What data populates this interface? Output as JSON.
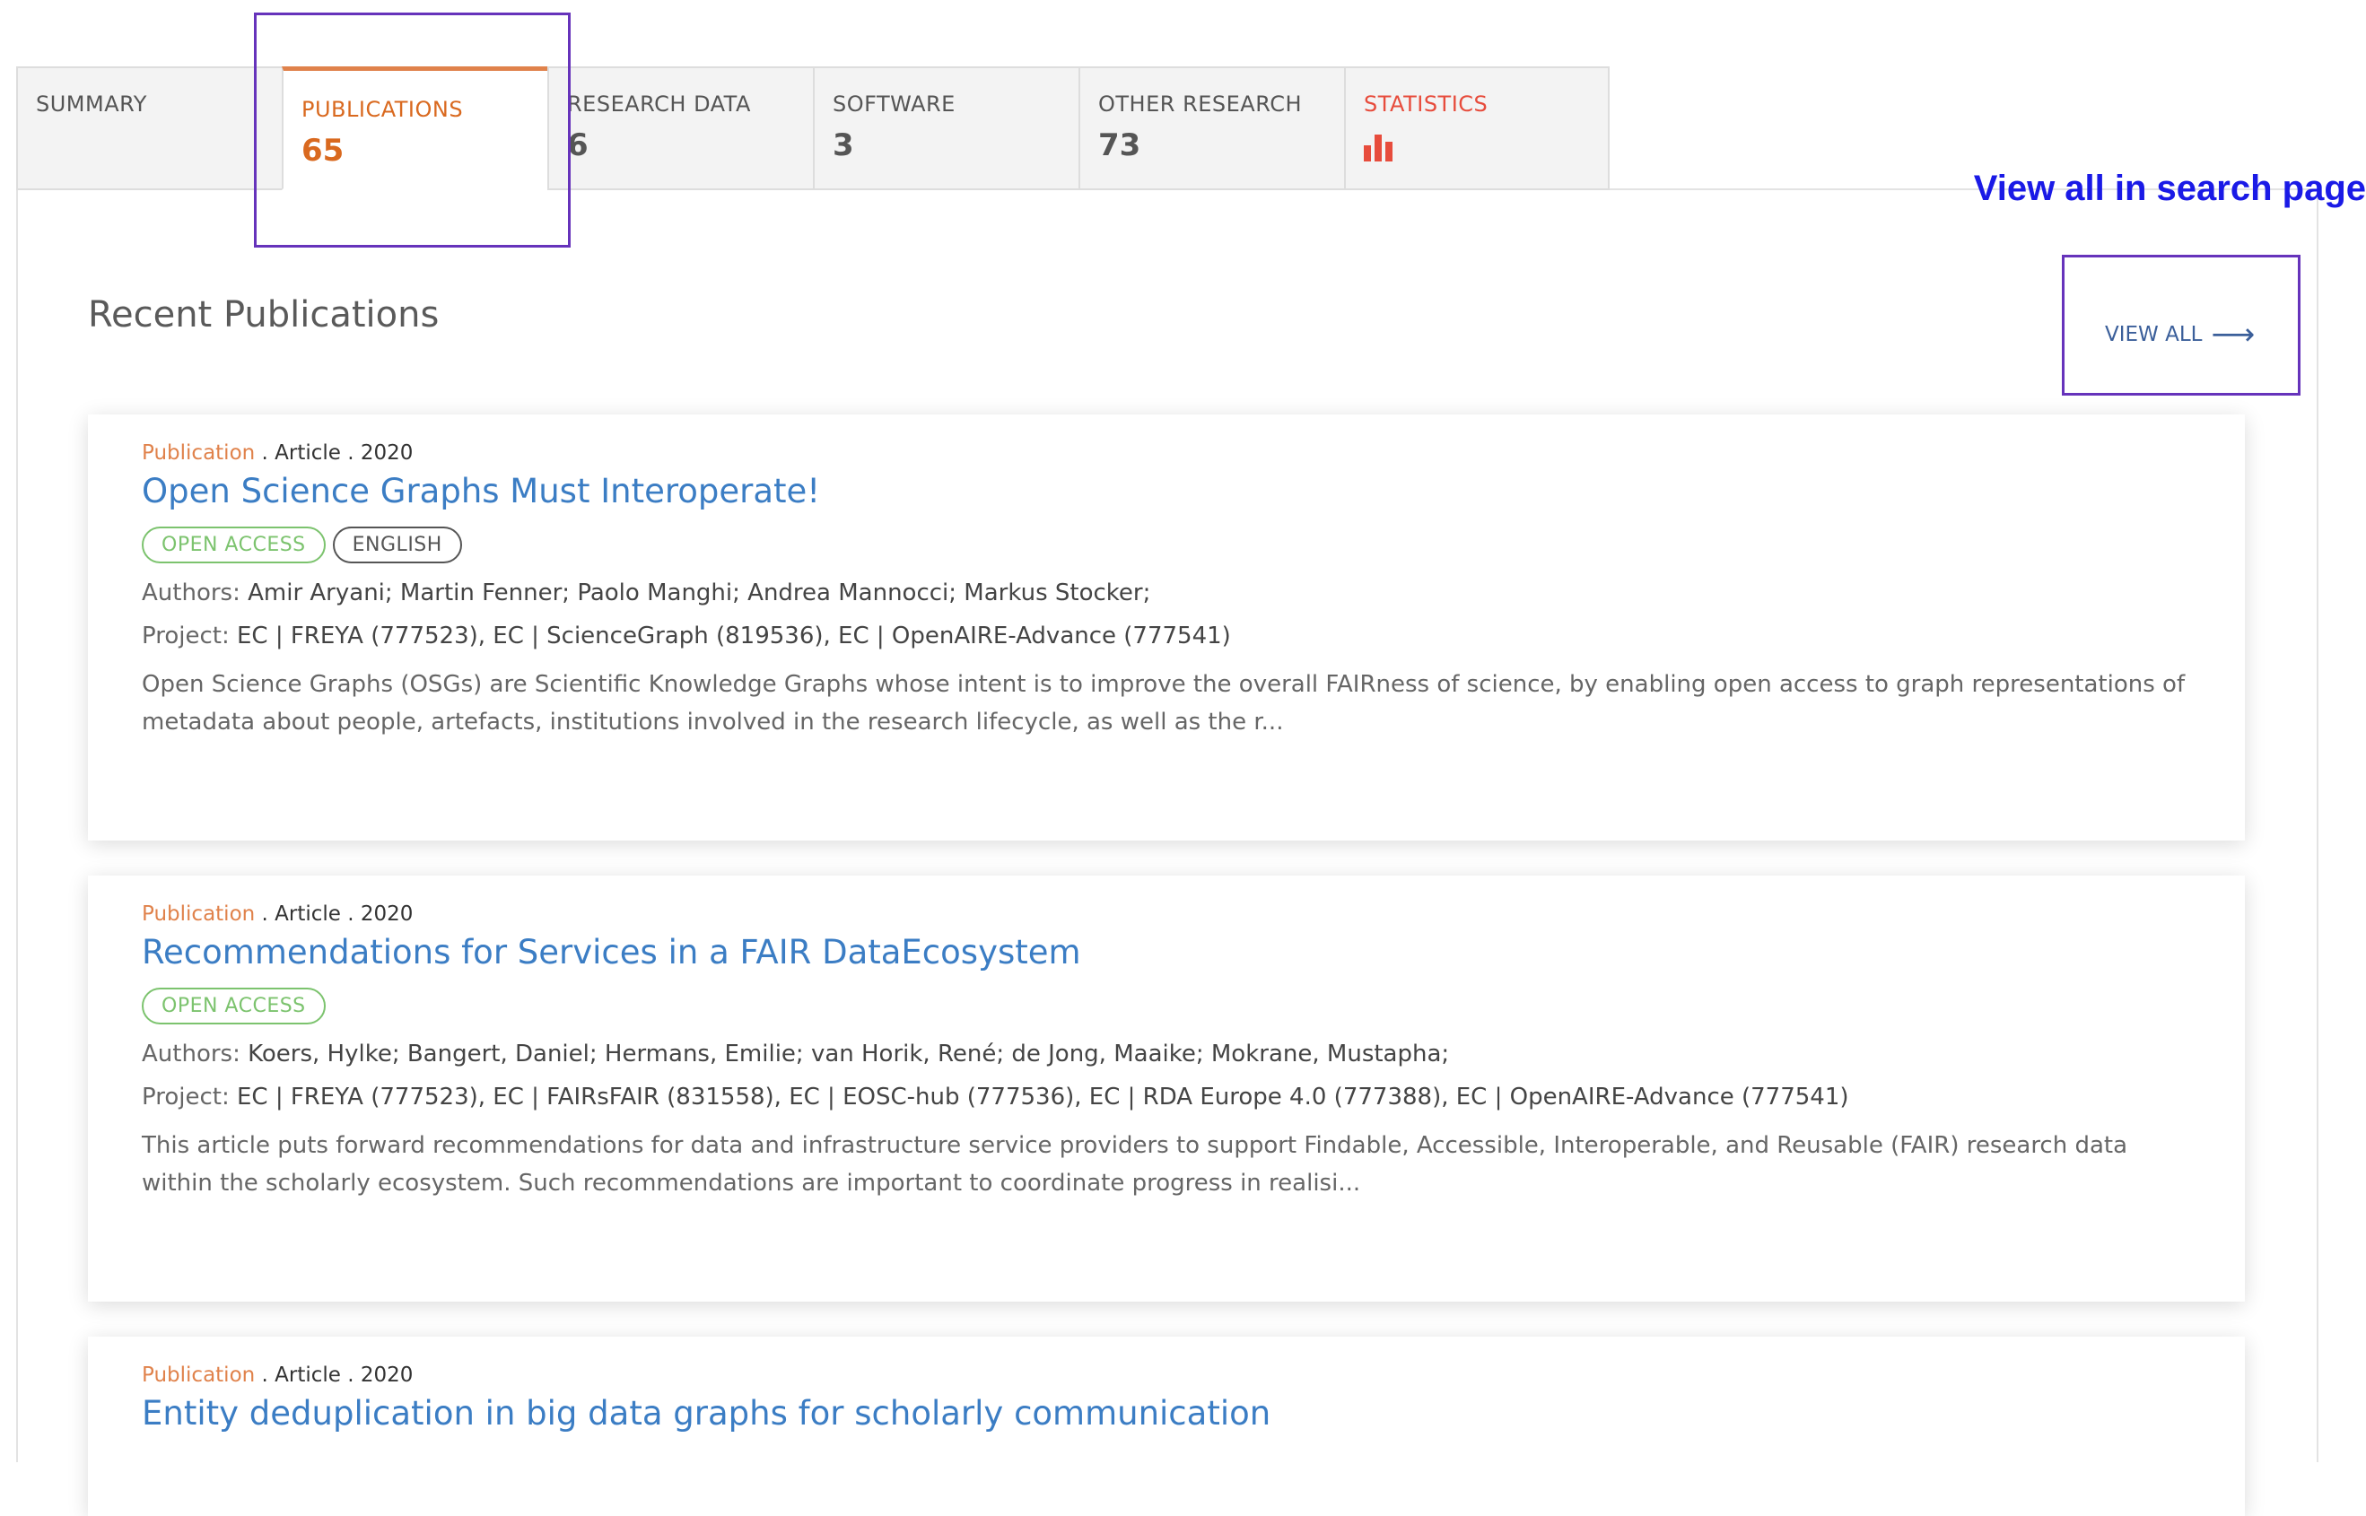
{
  "tabs": [
    {
      "label": "SUMMARY",
      "count": ""
    },
    {
      "label": "PUBLICATIONS",
      "count": "65"
    },
    {
      "label": "RESEARCH DATA",
      "count": "6"
    },
    {
      "label": "SOFTWARE",
      "count": "3"
    },
    {
      "label": "OTHER RESEARCH",
      "count": "73"
    },
    {
      "label": "STATISTICS",
      "count": ""
    }
  ],
  "annotation": "View all in search page",
  "section_title": "Recent Publications",
  "view_all": "VIEW ALL",
  "colors": {
    "accent": "#d9691f",
    "link": "#3b7dc4",
    "open_access": "#7cc36e",
    "highlight": "#6633bb",
    "annotation": "#1a1ae6"
  },
  "publications": [
    {
      "type": "Publication",
      "meta": ". Article . 2020",
      "title": "Open Science Graphs Must Interoperate!",
      "badges": [
        "OPEN ACCESS",
        "ENGLISH"
      ],
      "authors_label": "Authors:",
      "authors": "Amir Aryani; Martin Fenner; Paolo Manghi; Andrea Mannocci; Markus Stocker;",
      "project_label": "Project:",
      "project": "EC | FREYA (777523), EC | ScienceGraph (819536), EC | OpenAIRE-Advance (777541)",
      "abstract": "Open Science Graphs (OSGs) are Scientific Knowledge Graphs whose intent is to improve the overall FAIRness of science, by enabling open access to graph representations of metadata about people, artefacts, institutions involved in the research lifecycle, as well as the r..."
    },
    {
      "type": "Publication",
      "meta": ". Article . 2020",
      "title": "Recommendations for Services in a FAIR DataEcosystem",
      "badges": [
        "OPEN ACCESS"
      ],
      "authors_label": "Authors:",
      "authors": "Koers, Hylke; Bangert, Daniel; Hermans, Emilie; van Horik, René; de Jong, Maaike; Mokrane, Mustapha;",
      "project_label": "Project:",
      "project": "EC | FREYA (777523), EC | FAIRsFAIR (831558), EC | EOSC-hub (777536), EC | RDA Europe 4.0 (777388), EC | OpenAIRE-Advance (777541)",
      "abstract": "This article puts forward recommendations for data and infrastructure service providers to support Findable, Accessible, Interoperable, and Reusable (FAIR) research data within the scholarly ecosystem. Such recommendations are important to coordinate progress in realisi..."
    },
    {
      "type": "Publication",
      "meta": ". Article . 2020",
      "title": "Entity deduplication in big data graphs for scholarly communication"
    }
  ]
}
